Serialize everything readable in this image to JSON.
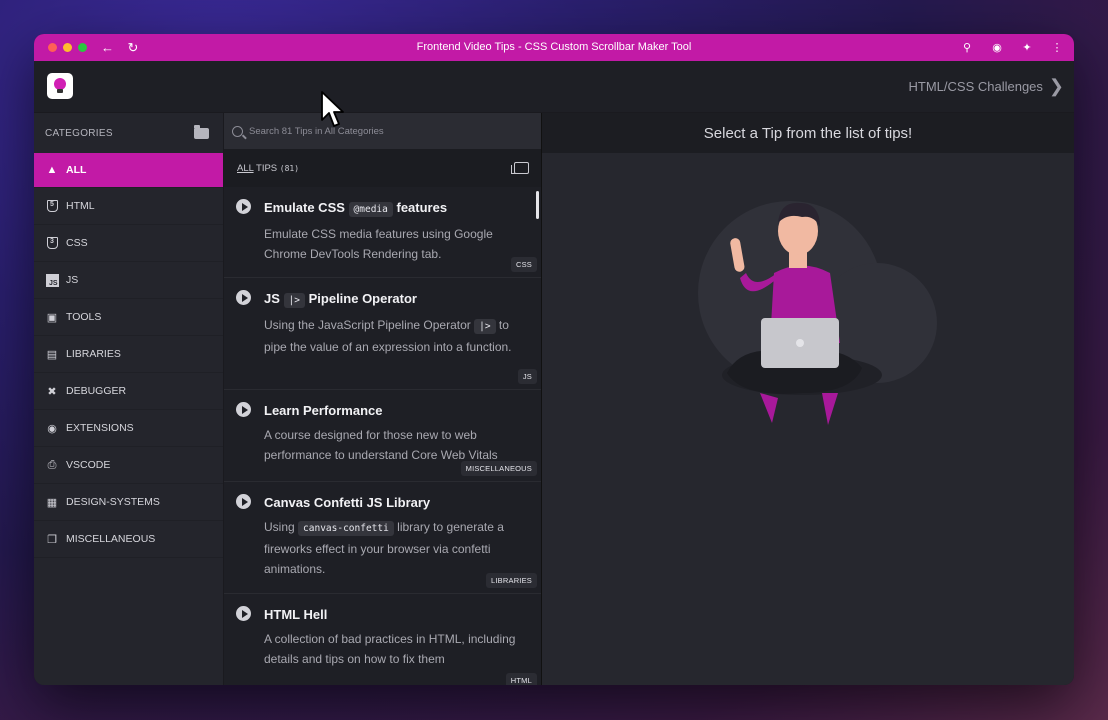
{
  "window": {
    "title": "Frontend Video Tips - CSS Custom Scrollbar Maker Tool"
  },
  "header": {
    "challenges_label": "HTML/CSS Challenges"
  },
  "sidebar": {
    "heading": "CATEGORIES",
    "items": [
      {
        "label": "ALL",
        "icon": "shapes-icon",
        "active": true
      },
      {
        "label": "HTML",
        "icon": "html5-icon"
      },
      {
        "label": "CSS",
        "icon": "css3-icon"
      },
      {
        "label": "JS",
        "icon": "js-icon"
      },
      {
        "label": "TOOLS",
        "icon": "toolbox-icon"
      },
      {
        "label": "LIBRARIES",
        "icon": "books-icon"
      },
      {
        "label": "DEBUGGER",
        "icon": "tools-icon"
      },
      {
        "label": "EXTENSIONS",
        "icon": "chrome-icon"
      },
      {
        "label": "VSCODE",
        "icon": "vscode-icon"
      },
      {
        "label": "DESIGN-SYSTEMS",
        "icon": "design-icon"
      },
      {
        "label": "MISCELLANEOUS",
        "icon": "copy-icon"
      }
    ]
  },
  "tips": {
    "search_placeholder": "Search 81 Tips in All Categories",
    "filter_all": "ALL",
    "filter_tips": "TIPS",
    "count": "(81)",
    "items": [
      {
        "title_pre": "Emulate CSS",
        "title_code": "@media",
        "title_post": "features",
        "desc": "Emulate CSS media features using Google Chrome DevTools Rendering tab.",
        "tag": "CSS"
      },
      {
        "title_pre": "JS",
        "title_code": "|>",
        "title_post": "Pipeline Operator",
        "desc_pre": "Using the JavaScript Pipeline Operator",
        "desc_code": "|>",
        "desc_post": "to pipe the value of an expression into a function.",
        "tag": "JS"
      },
      {
        "title": "Learn Performance",
        "desc": "A course designed for those new to web performance to understand Core Web Vitals",
        "tag": "MISCELLANEOUS"
      },
      {
        "title": "Canvas Confetti JS Library",
        "desc_pre": "Using",
        "desc_code": "canvas-confetti",
        "desc_post": "library to generate a fireworks effect in your browser via confetti animations.",
        "tag": "LIBRARIES"
      },
      {
        "title": "HTML Hell",
        "desc": "A collection of bad practices in HTML, including details and tips on how to fix them",
        "tag": "HTML"
      }
    ]
  },
  "main": {
    "heading": "Select a Tip from the list of tips!"
  },
  "colors": {
    "accent": "#c21aa6",
    "panel": "#24252c",
    "list_bg": "#1e1f25",
    "main_bg": "#26272e"
  }
}
